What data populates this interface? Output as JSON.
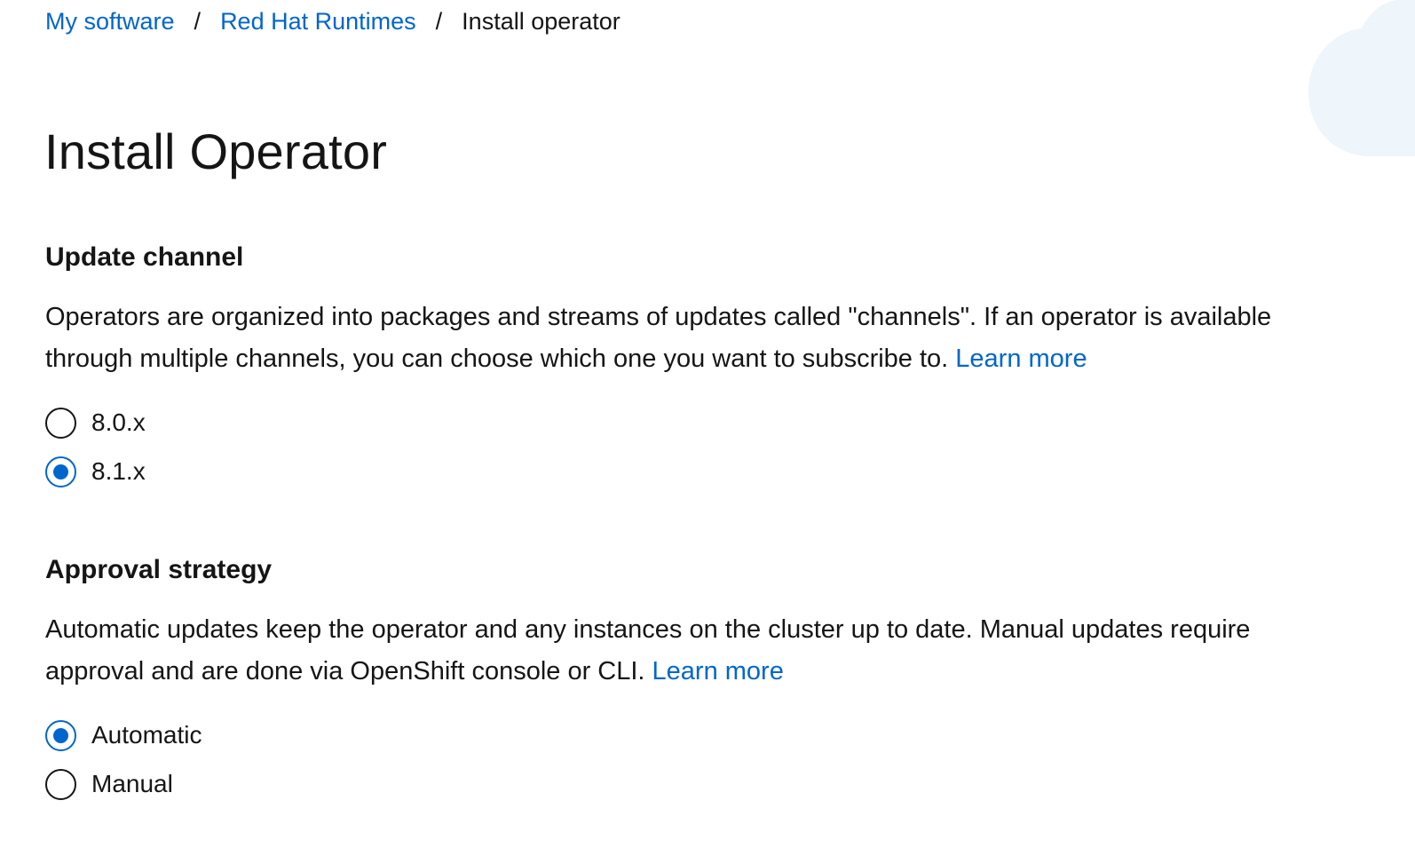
{
  "breadcrumb": {
    "items": [
      "My software",
      "Red Hat Runtimes"
    ],
    "separator": "/",
    "current": "Install operator"
  },
  "page": {
    "title": "Install Operator"
  },
  "update_channel": {
    "title": "Update channel",
    "description": "Operators are organized into packages and streams of updates called \"channels\". If an operator is available through multiple channels, you can choose which one you want to subscribe to.",
    "learn_more": "Learn more",
    "options": [
      {
        "label": "8.0.x",
        "selected": false
      },
      {
        "label": "8.1.x",
        "selected": true
      }
    ]
  },
  "approval_strategy": {
    "title": "Approval strategy",
    "description": "Automatic updates keep the operator and any instances on the cluster up to date. Manual updates require approval and are done via OpenShift console or CLI.",
    "learn_more": "Learn more",
    "options": [
      {
        "label": "Automatic",
        "selected": true
      },
      {
        "label": "Manual",
        "selected": false
      }
    ]
  },
  "colors": {
    "link": "#0066cc",
    "text": "#151515",
    "radio_selected": "#0066cc",
    "background": "#ffffff",
    "decoration": "#eef5fb"
  }
}
